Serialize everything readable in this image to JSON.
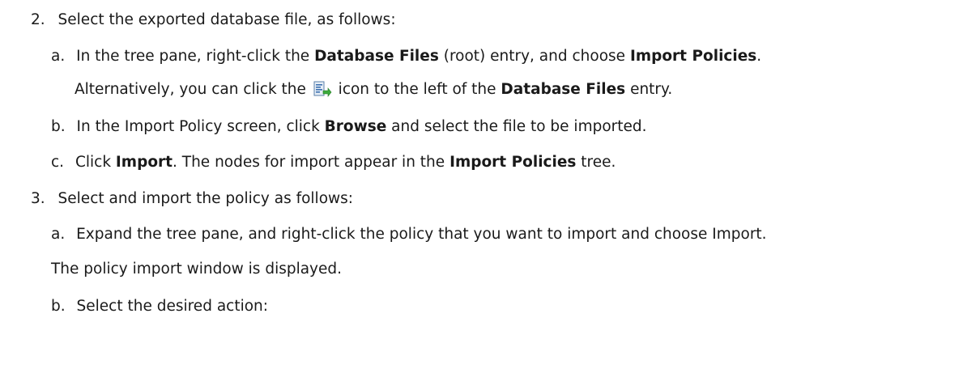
{
  "steps": [
    {
      "num": "2.",
      "text": "Select the exported database file, as follows:",
      "substeps": [
        {
          "letter": "a.",
          "t1": "In the tree pane, right-click the ",
          "b1": "Database Files",
          "t2": " (root) entry, and choose ",
          "b2": "Import Policies",
          "t3": ".",
          "cont_t1": "Alternatively, you can click the ",
          "icon": "import-policies-icon",
          "cont_t2": " icon to the left of the ",
          "cont_b1": "Database Files",
          "cont_t3": " entry."
        },
        {
          "letter": "b.",
          "t1": "In the Import Policy screen, click ",
          "b1": "Browse",
          "t2": " and select the file to be imported."
        },
        {
          "letter": "c.",
          "t1": "Click ",
          "b1": "Import",
          "t2": ". The nodes for import appear in the ",
          "b2": "Import Policies",
          "t3": " tree."
        }
      ]
    },
    {
      "num": "3.",
      "text": "Select and import the policy as follows:",
      "substeps": [
        {
          "letter": "a.",
          "t1": "Expand the tree pane, and right-click the policy that you want to import and choose Import.",
          "cont": "The policy import window is displayed."
        },
        {
          "letter": "b.",
          "t1": "Select the desired action:"
        }
      ]
    }
  ]
}
